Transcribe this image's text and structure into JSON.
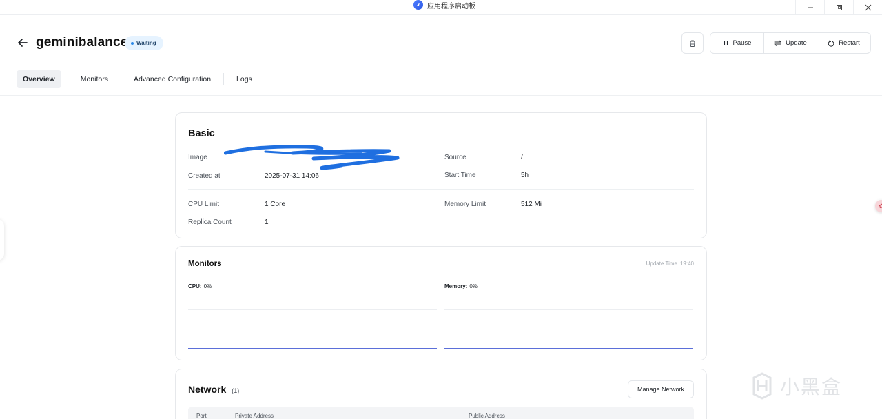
{
  "window": {
    "title": "应用程序启动板",
    "controls": [
      "minimize",
      "restore",
      "close"
    ]
  },
  "header": {
    "app_name": "geminibalance",
    "status": "Waiting",
    "actions": {
      "pause": "Pause",
      "update": "Update",
      "restart": "Restart"
    }
  },
  "tabs": [
    {
      "label": "Overview",
      "active": true
    },
    {
      "label": "Monitors",
      "active": false
    },
    {
      "label": "Advanced Configuration",
      "active": false
    },
    {
      "label": "Logs",
      "active": false
    }
  ],
  "basic": {
    "title": "Basic",
    "image_label": "Image",
    "image_value": "",
    "source_label": "Source",
    "source_value": "/",
    "created_label": "Created at",
    "created_value": "2025-07-31 14:06",
    "start_label": "Start Time",
    "start_value": "5h",
    "cpu_label": "CPU Limit",
    "cpu_value": "1 Core",
    "mem_label": "Memory Limit",
    "mem_value": "512 Mi",
    "replica_label": "Replica Count",
    "replica_value": "1"
  },
  "monitors": {
    "title": "Monitors",
    "update_label": "Update Time",
    "update_value": "19:40",
    "cpu_label": "CPU:",
    "cpu_value": "0%",
    "mem_label": "Memory:",
    "mem_value": "0%"
  },
  "network": {
    "title": "Network",
    "count": "(1)",
    "manage_label": "Manage Network",
    "columns": [
      "Port",
      "Private Address",
      "Public Address"
    ]
  },
  "watermark": {
    "text": "小黑盒"
  },
  "colors": {
    "accent": "#2b89e8",
    "badge_bg": "#e6f3ff",
    "chart_line": "#5b6fd9",
    "redaction": "#1f6fe0"
  }
}
